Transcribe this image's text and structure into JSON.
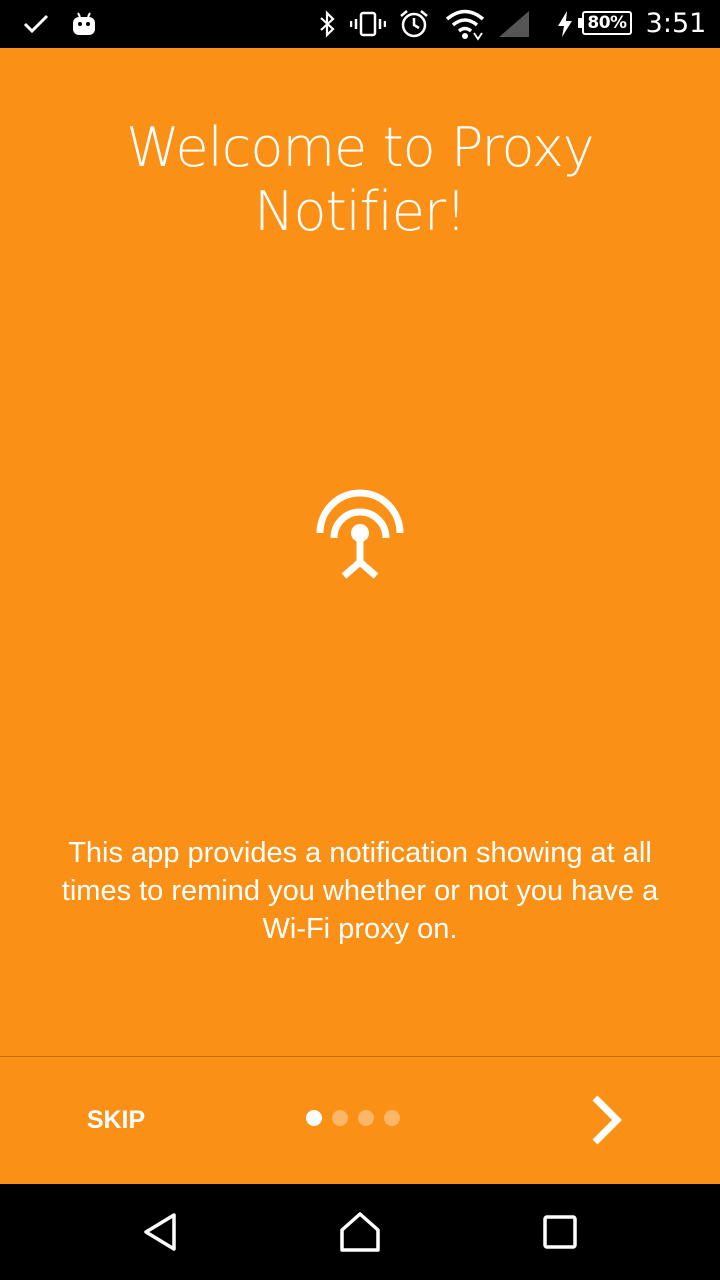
{
  "status_bar": {
    "left_icons": [
      "check-icon",
      "android-icon"
    ],
    "right_icons": [
      "bluetooth-icon",
      "vibrate-icon",
      "alarm-icon",
      "wifi-icon",
      "cell-signal-icon",
      "charging-icon"
    ],
    "battery_level": "80%",
    "time": "3:51"
  },
  "intro": {
    "title_line1": "Welcome to Proxy",
    "title_line2": "Notifier!",
    "hero_icon": "antenna-icon",
    "description": "This app provides a notification showing at all times to remind you whether or not you have a Wi-Fi proxy on."
  },
  "footer": {
    "skip_label": "SKIP",
    "page_count": 4,
    "current_page": 1,
    "next_icon": "chevron-right-icon"
  },
  "nav_bar": {
    "buttons": [
      "back-icon",
      "home-icon",
      "recents-icon"
    ]
  },
  "colors": {
    "accent": "#FA9016",
    "divider": "#C46A08",
    "bars": "#000000"
  }
}
